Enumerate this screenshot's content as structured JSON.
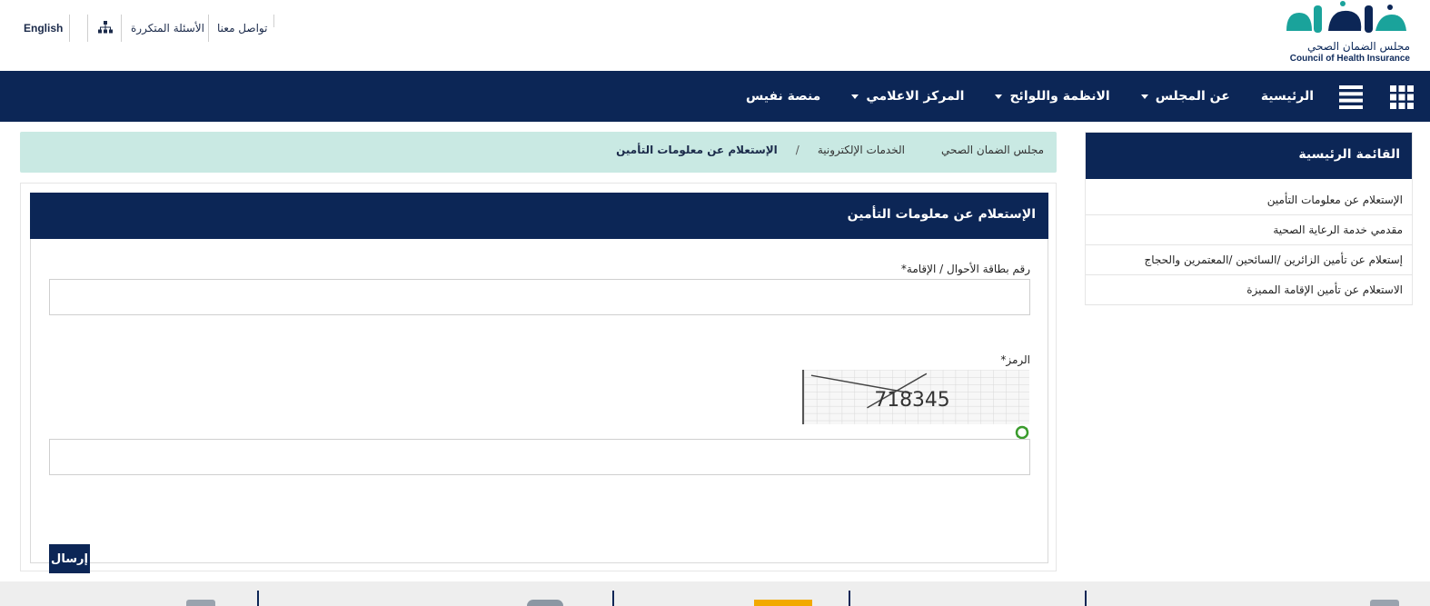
{
  "brand": {
    "logo_ar": "ضمان",
    "logo_sub": "مجلس الضمان الصحي",
    "logo_en": "Council of Health Insurance",
    "primary_color": "#0c2656",
    "accent_color": "#1aa39b"
  },
  "top_links": {
    "language": "English",
    "sitemap_icon": "sitemap-icon",
    "faq": "الأسئلة المتكررة",
    "contact": "تواصل معنا"
  },
  "nav": {
    "items": [
      {
        "label": "الرئيسية",
        "has_dropdown": false
      },
      {
        "label": "عن المجلس",
        "has_dropdown": true
      },
      {
        "label": "الانظمة واللوائح",
        "has_dropdown": true
      },
      {
        "label": "المركز الاعلامي",
        "has_dropdown": true
      },
      {
        "label": "منصة نفيس",
        "has_dropdown": false
      }
    ],
    "grid_icon": "apps-grid-icon",
    "menu_icon": "hamburger-icon"
  },
  "breadcrumb": {
    "items": [
      "مجلس الضمان الصحي",
      "الخدمات الإلكترونية",
      "الإستعلام عن معلومات التأمين"
    ],
    "separator": "/"
  },
  "form": {
    "title": "الإستعلام عن معلومات التأمين",
    "id_label": "رقم بطاقة الأحوال / الإقامة*",
    "id_value": "",
    "captcha_label": "الرمز*",
    "captcha_text": "718345",
    "captcha_value": "",
    "refresh_icon": "refresh-icon",
    "submit_label": "إرسال"
  },
  "side_menu": {
    "title": "القائمة الرئيسية",
    "items": [
      "الإستعلام عن معلومات التأمين",
      "مقدمي خدمة الرعاية الصحية",
      "إستعلام عن تأمين الزائرين /السائحين /المعتمرين والحجاج",
      "الاستعلام عن تأمين الإقامة المميزة"
    ]
  }
}
